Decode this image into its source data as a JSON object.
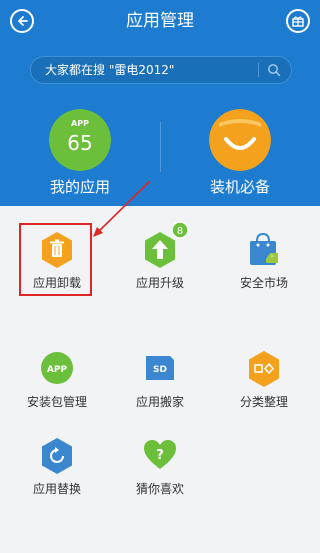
{
  "header": {
    "title": "应用管理",
    "search_placeholder": "大家都在搜 \"雷电2012\""
  },
  "top_apps": [
    {
      "label": "我的应用",
      "badge_text": "APP",
      "count": "65"
    },
    {
      "label": "装机必备"
    }
  ],
  "grid": [
    {
      "label": "应用卸载"
    },
    {
      "label": "应用升级",
      "badge": "8"
    },
    {
      "label": "安全市场"
    },
    {
      "label": "安装包管理",
      "badge_text": "APP"
    },
    {
      "label": "应用搬家",
      "badge_text": "SD"
    },
    {
      "label": "分类整理"
    },
    {
      "label": "应用替换"
    },
    {
      "label": "猜你喜欢"
    }
  ],
  "colors": {
    "header_bg": "#1d7ccf",
    "green": "#6cbf3a",
    "orange": "#f4a11d",
    "blue": "#3a87cf",
    "annotation_red": "#e02525"
  }
}
